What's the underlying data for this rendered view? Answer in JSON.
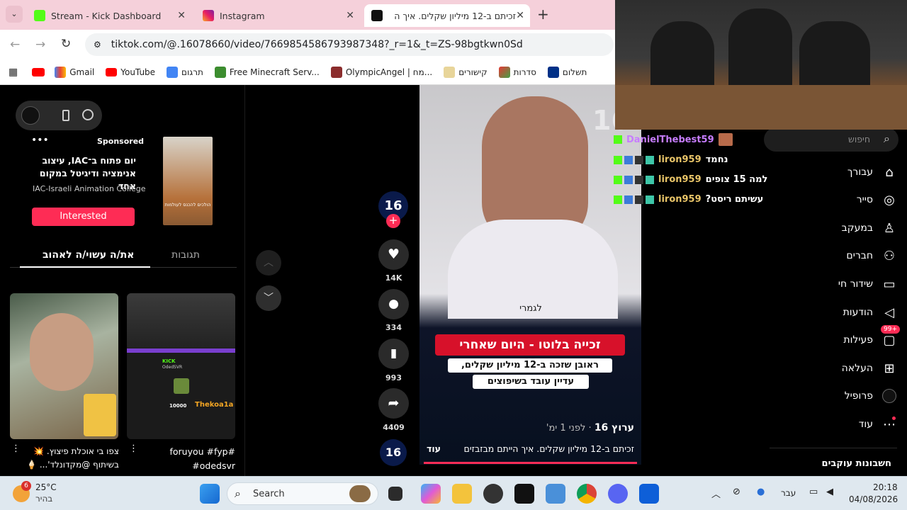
{
  "browser": {
    "tabs": [
      {
        "title": "Stream - Kick Dashboard"
      },
      {
        "title": "Instagram"
      },
      {
        "title": "זכיתם ב-12 מיליון שקלים. איך ה"
      }
    ],
    "url": "tiktok.com/@.16078660/video/7669854586793987348?_r=1&_t=ZS-98bgtkwn0Sd",
    "bookmarks": [
      "Gmail",
      "YouTube",
      "תרגום",
      "Free Minecraft Serv...",
      "OlympicAngel | מח...",
      "קישורים",
      "סדרות",
      "תשלום"
    ]
  },
  "ad": {
    "sponsored": "Sponsored",
    "headline_line1": "יום פתוח ב־IAC, עיצוב",
    "headline_line2": "אנימציה ודיגיטל במקום אחד",
    "advertiser": "IAC-Israeli Animation College",
    "cta": "Interested",
    "thumb_caption": "הולכים להכנס לעולמות"
  },
  "tabs": {
    "you_may_like": "את/ה עשוי/ה לאהוב",
    "comments": "תגובות"
  },
  "suggested": [
    {
      "caption_line1": "צפו בי אוכלת פיצוץ. 💥",
      "caption_line2": "בשיתוף @מקדונלד'... 🍦"
    },
    {
      "caption_line1": "foruyou #fyp#",
      "caption_line2": "#odedsvr",
      "overlay_kick": "KICK",
      "overlay_user": "OdedSVR",
      "overlay_counter": "10000",
      "overlay_name": "Thekoa1a"
    }
  ],
  "video": {
    "channel_badge": "16",
    "subtitle": "לגמרי",
    "banner_title": "זכייה בלוטו - היום שאחרי",
    "banner_line1": "ראובן שזכה ב-12 מיליון שקלים,",
    "banner_line2": "עדיין עובד בשיפוצים",
    "author": "ערוץ 16",
    "time_ago": "· לפני 1 ימ'",
    "description": "זכיתם ב-12 מיליון שקלים. איך הייתם מבזבזים",
    "more": "עוד"
  },
  "actions": {
    "likes": "14K",
    "comments": "334",
    "saves": "993",
    "shares": "4409"
  },
  "chat": [
    {
      "user": "DanielThebest59",
      "text": "",
      "user_color": "#c77dff"
    },
    {
      "user": "liron959",
      "text": "נחמד",
      "user_color": "#e8c468"
    },
    {
      "user": "liron959",
      "text": "למה 15 צופים",
      "user_color": "#e8c468"
    },
    {
      "user": "liron959",
      "text": "עשיתם ריסט?",
      "user_color": "#e8c468"
    }
  ],
  "sidebar": {
    "search_placeholder": "חיפוש",
    "items": [
      {
        "label": "עבורך",
        "icon": "home-icon"
      },
      {
        "label": "סייר",
        "icon": "compass-icon"
      },
      {
        "label": "במעקב",
        "icon": "following-icon"
      },
      {
        "label": "חברים",
        "icon": "friends-icon"
      },
      {
        "label": "שידור חי",
        "icon": "live-icon"
      },
      {
        "label": "הודעות",
        "icon": "send-icon"
      },
      {
        "label": "פעילות",
        "icon": "activity-icon",
        "badge": "99+"
      },
      {
        "label": "העלאה",
        "icon": "upload-icon"
      },
      {
        "label": "פרופיל",
        "icon": "profile-icon"
      },
      {
        "label": "עוד",
        "icon": "more-icon"
      }
    ],
    "following_accounts": "חשבונות עוקבים"
  },
  "taskbar": {
    "weather_temp": "25°C",
    "weather_desc": "בהיר",
    "weather_badge": "6",
    "search": "Search",
    "lang": "עבר",
    "time": "20:18",
    "date": "04/08/2026"
  },
  "colors": {
    "tiktok_red": "#fe2c55",
    "kick_green": "#53fc18",
    "banner_red": "#d7112a"
  }
}
